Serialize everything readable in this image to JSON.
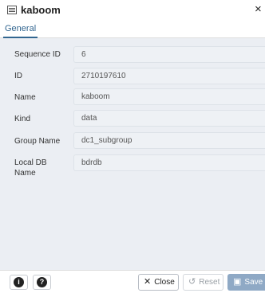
{
  "dialog": {
    "title": "kaboom",
    "title_icon": "sequence-icon",
    "close_icon": "close-icon",
    "close_glyph": "×"
  },
  "tabs": [
    {
      "label": "General",
      "active": true
    }
  ],
  "fields": [
    {
      "label": "Sequence ID",
      "value": "6"
    },
    {
      "label": "ID",
      "value": "2710197610"
    },
    {
      "label": "Name",
      "value": "kaboom"
    },
    {
      "label": "Kind",
      "value": "data"
    },
    {
      "label": "Group Name",
      "value": "dc1_subgroup"
    },
    {
      "label": "Local DB Name",
      "value": "bdrdb"
    }
  ],
  "footer": {
    "info_icon": "info-icon",
    "help_icon": "help-icon",
    "info_glyph": "i",
    "help_glyph": "?",
    "close_label": "Close",
    "close_glyph": "✕",
    "reset_label": "Reset",
    "reset_glyph": "↺",
    "save_label": "Save",
    "save_glyph": "▣"
  },
  "colors": {
    "accent": "#326690",
    "content_bg": "#ebeef3",
    "save_bg": "#8fa9c5"
  }
}
